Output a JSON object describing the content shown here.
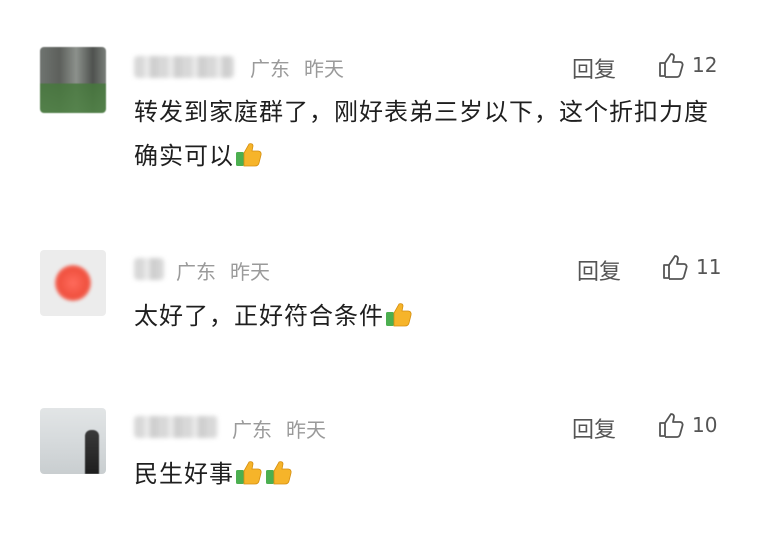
{
  "comments": [
    {
      "location": "广东",
      "time": "昨天",
      "reply_label": "回复",
      "like_count": "12",
      "text": "转发到家庭群了，刚好表弟三岁以下，这个折扣力度确实可以",
      "emoji": [
        "thumbs-up-icon"
      ]
    },
    {
      "location": "广东",
      "time": "昨天",
      "reply_label": "回复",
      "like_count": "11",
      "text": "太好了，正好符合条件",
      "emoji": [
        "thumbs-up-icon"
      ]
    },
    {
      "location": "广东",
      "time": "昨天",
      "reply_label": "回复",
      "like_count": "10",
      "text": "民生好事",
      "emoji": [
        "thumbs-up-icon",
        "thumbs-up-icon"
      ]
    }
  ],
  "colors": {
    "meta": "#9a9a9a",
    "text": "#1f1f1f",
    "action": "#555555",
    "emoji_yellow": "#f6b42a",
    "emoji_green": "#4caf50"
  }
}
